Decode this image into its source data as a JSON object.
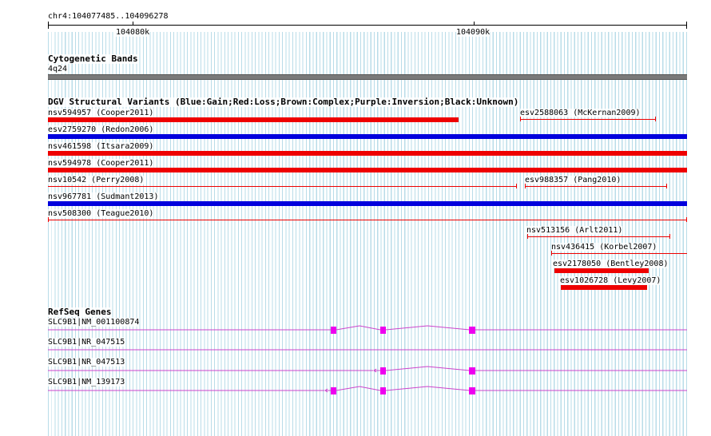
{
  "location": "chr4:104077485..104096278",
  "ruler": {
    "labels": [
      "104080k",
      "104090k"
    ]
  },
  "cytoband": {
    "title": "Cytogenetic Bands",
    "band": "4q24"
  },
  "dgv": {
    "title": "DGV Structural Variants (Blue:Gain;Red:Loss;Brown:Complex;Purple:Inversion;Black:Unknown)",
    "colors": {
      "gain": "#0000dd",
      "loss": "#ee0000"
    },
    "variants": [
      "nsv594957 (Cooper2011)",
      "esv2588063 (McKernan2009)",
      "esv2759270 (Redon2006)",
      "nsv461598 (Itsara2009)",
      "nsv594978 (Cooper2011)",
      "nsv10542 (Perry2008)",
      "esv988357 (Pang2010)",
      "nsv967781 (Sudmant2013)",
      "nsv508300 (Teague2010)",
      "nsv513156 (Arlt2011)",
      "nsv436415 (Korbel2007)",
      "esv2178050 (Bentley2008)",
      "esv1026728 (Levy2007)"
    ]
  },
  "refseq": {
    "title": "RefSeq Genes",
    "color": "#ee00ee",
    "genes": [
      "SLC9B1|NM_001100874",
      "SLC9B1|NR_047515",
      "SLC9B1|NR_047513",
      "SLC9B1|NM_139173"
    ]
  }
}
